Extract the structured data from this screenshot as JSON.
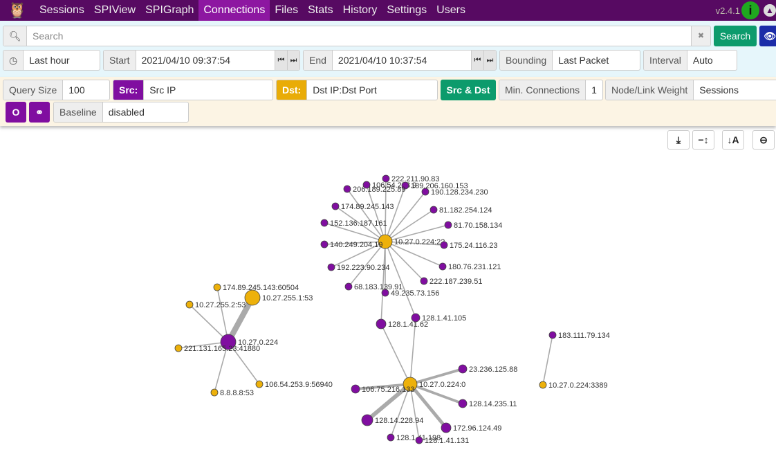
{
  "nav": {
    "items": [
      "Sessions",
      "SPIView",
      "SPIGraph",
      "Connections",
      "Files",
      "Stats",
      "History",
      "Settings",
      "Users"
    ],
    "active": "Connections",
    "version": "v2.4.1"
  },
  "search": {
    "placeholder": "Search",
    "button": "Search"
  },
  "time": {
    "range": "Last hour",
    "start_label": "Start",
    "start": "2021/04/10 09:37:54",
    "end_label": "End",
    "end": "2021/04/10 10:37:54",
    "bounding_label": "Bounding",
    "bounding": "Last Packet",
    "interval_label": "Interval",
    "interval": "Auto"
  },
  "options": {
    "query_size_label": "Query Size",
    "query_size": "100",
    "src_label": "Src:",
    "src": "Src IP",
    "dst_label": "Dst:",
    "dst": "Dst IP:Dst Port",
    "src_dst": "Src & Dst",
    "min_conn_label": "Min. Connections",
    "min_conn": "1",
    "weight_label": "Node/Link Weight",
    "weight": "Sessions",
    "baseline_label": "Baseline",
    "baseline": "disabled"
  },
  "colors": {
    "src": "#800ea0",
    "dst": "#edb10b",
    "nav": "#570a62",
    "green": "#0c9b6c"
  },
  "graph": {
    "nodes": [
      {
        "id": "10.27.0.224:22",
        "type": "dst"
      },
      {
        "id": "222.211.90.83",
        "type": "src"
      },
      {
        "id": "106.54.253.9",
        "type": "src"
      },
      {
        "id": "189.206.160.153",
        "type": "src"
      },
      {
        "id": "206.189.225.89",
        "type": "src"
      },
      {
        "id": "190.128.234.230",
        "type": "src"
      },
      {
        "id": "174.89.245.143",
        "type": "src"
      },
      {
        "id": "81.182.254.124",
        "type": "src"
      },
      {
        "id": "152.136.187.161",
        "type": "src"
      },
      {
        "id": "81.70.158.134",
        "type": "src"
      },
      {
        "id": "140.249.204.19",
        "type": "src"
      },
      {
        "id": "175.24.116.23",
        "type": "src"
      },
      {
        "id": "180.76.231.121",
        "type": "src"
      },
      {
        "id": "192.223.90.234",
        "type": "src"
      },
      {
        "id": "222.187.239.51",
        "type": "src"
      },
      {
        "id": "68.183.139.91",
        "type": "src"
      },
      {
        "id": "49.235.73.156",
        "type": "src"
      },
      {
        "id": "128.1.41.62",
        "type": "src"
      },
      {
        "id": "128.1.41.105",
        "type": "src"
      },
      {
        "id": "10.27.0.224:0",
        "type": "dst"
      },
      {
        "id": "23.236.125.88",
        "type": "src"
      },
      {
        "id": "106.75.216.133",
        "type": "src"
      },
      {
        "id": "128.14.235.11",
        "type": "src"
      },
      {
        "id": "128.14.228.94",
        "type": "src"
      },
      {
        "id": "172.96.124.49",
        "type": "src"
      },
      {
        "id": "128.1.41.198",
        "type": "src"
      },
      {
        "id": "128.1.41.131",
        "type": "src"
      },
      {
        "id": "10.27.0.224",
        "type": "src"
      },
      {
        "id": "174.89.245.143:60504",
        "type": "dst"
      },
      {
        "id": "10.27.255.1:53",
        "type": "dst"
      },
      {
        "id": "10.27.255.2:53",
        "type": "dst"
      },
      {
        "id": "221.131.165.23:41880",
        "type": "dst"
      },
      {
        "id": "106.54.253.9:56940",
        "type": "dst"
      },
      {
        "id": "8.8.8.8:53",
        "type": "dst"
      },
      {
        "id": "183.111.79.134",
        "type": "src"
      },
      {
        "id": "10.27.0.224:3389",
        "type": "dst"
      }
    ],
    "links": [
      [
        1,
        0,
        1
      ],
      [
        2,
        0,
        1
      ],
      [
        3,
        0,
        1
      ],
      [
        4,
        0,
        1
      ],
      [
        5,
        0,
        1
      ],
      [
        6,
        0,
        1
      ],
      [
        7,
        0,
        1
      ],
      [
        8,
        0,
        1
      ],
      [
        9,
        0,
        1
      ],
      [
        10,
        0,
        1
      ],
      [
        11,
        0,
        1
      ],
      [
        12,
        0,
        1
      ],
      [
        13,
        0,
        1
      ],
      [
        14,
        0,
        1
      ],
      [
        15,
        0,
        1
      ],
      [
        16,
        0,
        1
      ],
      [
        17,
        0,
        1
      ],
      [
        18,
        0,
        1
      ],
      [
        17,
        19,
        1
      ],
      [
        18,
        19,
        1
      ],
      [
        20,
        19,
        3
      ],
      [
        21,
        19,
        3
      ],
      [
        22,
        19,
        3
      ],
      [
        23,
        19,
        5
      ],
      [
        24,
        19,
        4
      ],
      [
        25,
        19,
        1
      ],
      [
        26,
        19,
        1
      ],
      [
        27,
        28,
        1
      ],
      [
        27,
        29,
        7
      ],
      [
        27,
        30,
        1
      ],
      [
        27,
        31,
        1
      ],
      [
        27,
        32,
        1
      ],
      [
        27,
        33,
        1
      ],
      [
        34,
        35,
        1
      ]
    ]
  }
}
